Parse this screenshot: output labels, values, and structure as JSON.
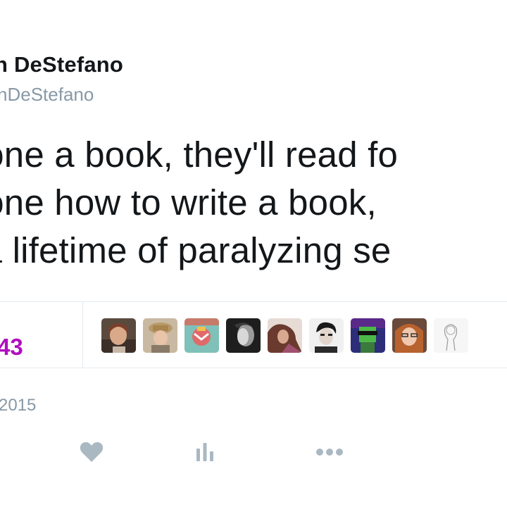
{
  "author": {
    "display_name": "n DeStefano",
    "username": "nDeStefano"
  },
  "tweet": {
    "lines": [
      "meone a book, they'll read fo",
      "meone how to write a book,",
      "ce a lifetime of paralyzing se"
    ],
    "timestamp": "2015"
  },
  "stats": {
    "likes_count": "43",
    "likes_label": ""
  },
  "likers": [
    {
      "name": "avatar-1",
      "bg": "#6e5a4a"
    },
    {
      "name": "avatar-2",
      "bg": "#b8a68c"
    },
    {
      "name": "avatar-3",
      "bg": "#d56b6b"
    },
    {
      "name": "avatar-4",
      "bg": "#2b2b2b"
    },
    {
      "name": "avatar-5",
      "bg": "#8a5b4a"
    },
    {
      "name": "avatar-6",
      "bg": "#e8e8e8"
    },
    {
      "name": "avatar-7",
      "bg": "#3b3f8f"
    },
    {
      "name": "avatar-8",
      "bg": "#a06a4e"
    },
    {
      "name": "avatar-9",
      "bg": "#f4f4f4"
    }
  ],
  "actions": [
    {
      "name": "like-heart-icon"
    },
    {
      "name": "analytics-icon"
    },
    {
      "name": "more-icon"
    }
  ],
  "colors": {
    "accent_likes": "#b00fbf",
    "secondary_text": "#8899a6",
    "icon_gray": "#aab8c2",
    "divider": "#e6ecf0"
  }
}
